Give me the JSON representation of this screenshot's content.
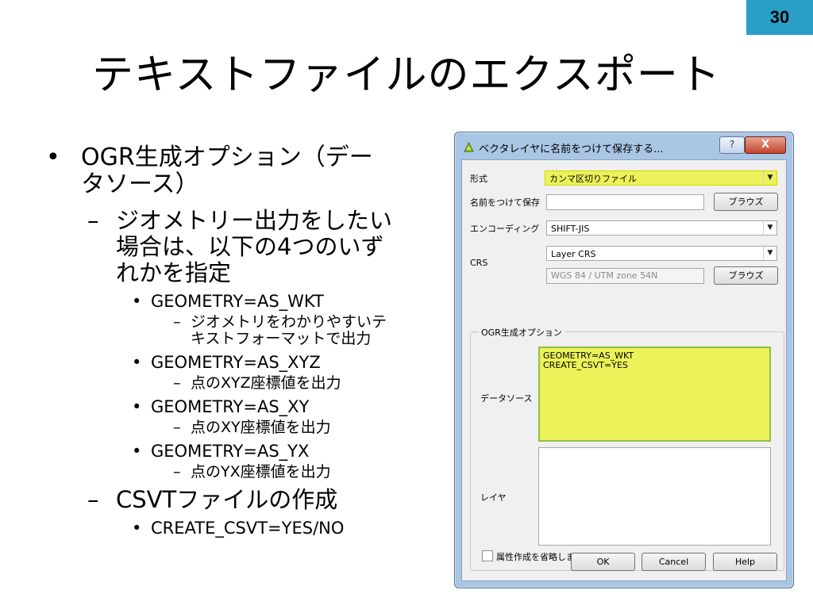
{
  "page_number": "30",
  "slide_title": "テキストファイルのエクスポート",
  "bullets": {
    "b1_mark": "•",
    "b1_line1": "OGR生成オプション（デー",
    "b1_line2": "タソース）",
    "b2_mark": "–",
    "b2_line1": "ジオメトリー出力をしたい",
    "b2_line2": "場合は、以下の4つのいず",
    "b2_line3": "れかを指定",
    "dot": "•",
    "dash": "–",
    "g1": "GEOMETRY=AS_WKT",
    "g1_desc_line1": "ジオメトリをわかりやすいテ",
    "g1_desc_line2": "キストフォーマットで出力",
    "g2": "GEOMETRY=AS_XYZ",
    "g2_desc": "点のXYZ座標値を出力",
    "g3": "GEOMETRY=AS_XY",
    "g3_desc": "点のXY座標値を出力",
    "g4": "GEOMETRY=AS_YX",
    "g4_desc": "点のYX座標値を出力",
    "csvt": "CSVTファイルの作成",
    "csvt_opt": "CREATE_CSVT=YES/NO"
  },
  "dialog": {
    "title": "ベクタレイヤに名前をつけて保存する...",
    "help_symbol": "?",
    "close_symbol": "X",
    "format_label": "形式",
    "format_value": "カンマ区切りファイル",
    "save_as_label": "名前をつけて保存",
    "save_as_value": "",
    "browse_label": "ブラウズ",
    "encoding_label": "エンコーディング",
    "encoding_value": "SHIFT-JIS",
    "crs_label": "CRS",
    "crs_value": "Layer CRS",
    "crs_detail": "WGS 84 / UTM zone 54N",
    "ogr_group_title": "OGR生成オプション",
    "datasource_label": "データソース",
    "datasource_value": "GEOMETRY=AS_WKT\nCREATE_CSVT=YES",
    "layer_label": "レイヤ",
    "layer_value": "",
    "skip_attr_label": "属性作成を省略します",
    "ok_label": "OK",
    "cancel_label": "Cancel",
    "help_label": "Help"
  }
}
